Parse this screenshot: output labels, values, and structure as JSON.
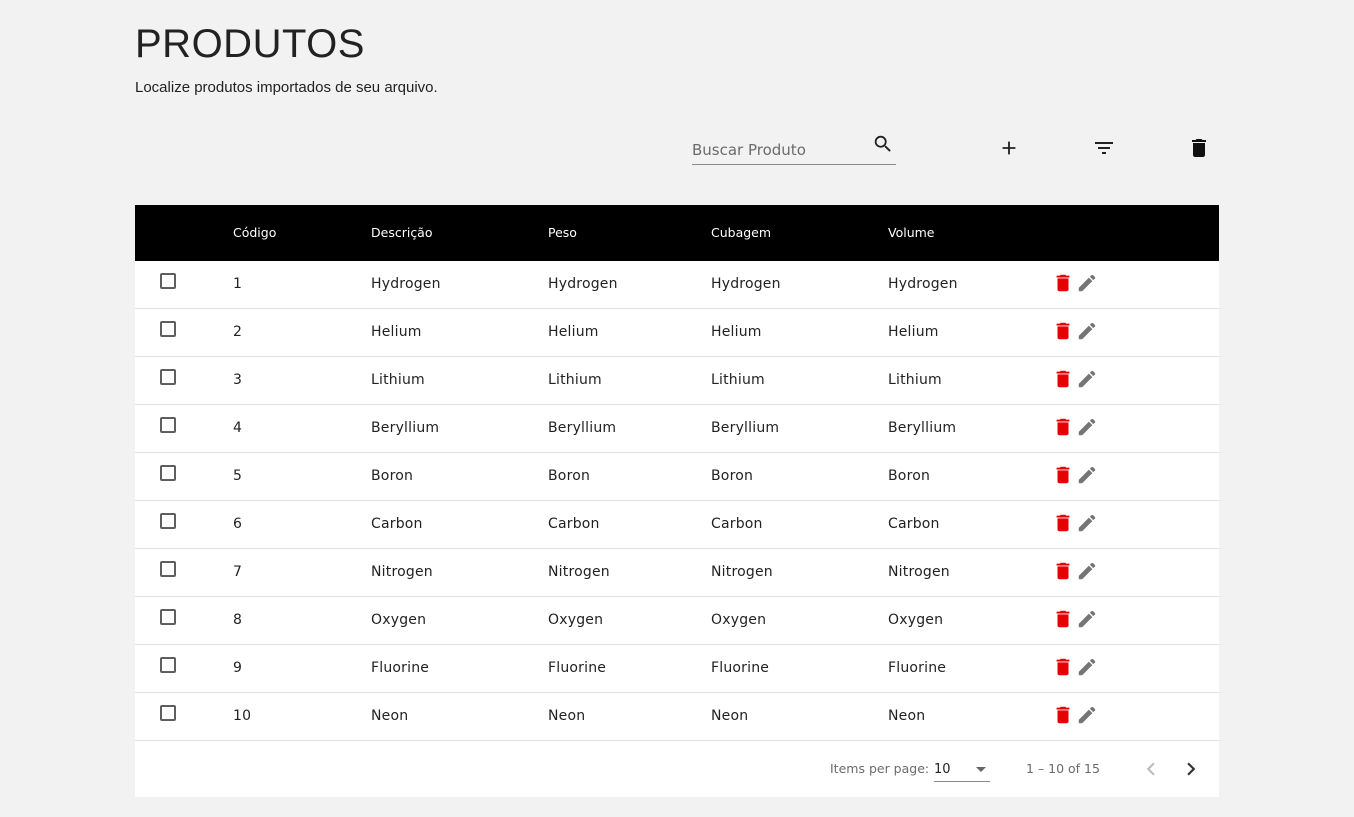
{
  "header": {
    "title": "PRODUTOS",
    "subtitle": "Localize produtos importados de seu arquivo."
  },
  "toolbar": {
    "search_placeholder": "Buscar Produto",
    "search_value": "",
    "icons": [
      "search-icon",
      "add-icon",
      "filter-icon",
      "delete-icon"
    ]
  },
  "table": {
    "columns": [
      "Código",
      "Descrição",
      "Peso",
      "Cubagem",
      "Volume"
    ],
    "rows": [
      {
        "codigo": "1",
        "descricao": "Hydrogen",
        "peso": "Hydrogen",
        "cubagem": "Hydrogen",
        "volume": "Hydrogen",
        "checked": false
      },
      {
        "codigo": "2",
        "descricao": "Helium",
        "peso": "Helium",
        "cubagem": "Helium",
        "volume": "Helium",
        "checked": false
      },
      {
        "codigo": "3",
        "descricao": "Lithium",
        "peso": "Lithium",
        "cubagem": "Lithium",
        "volume": "Lithium",
        "checked": false
      },
      {
        "codigo": "4",
        "descricao": "Beryllium",
        "peso": "Beryllium",
        "cubagem": "Beryllium",
        "volume": "Beryllium",
        "checked": false
      },
      {
        "codigo": "5",
        "descricao": "Boron",
        "peso": "Boron",
        "cubagem": "Boron",
        "volume": "Boron",
        "checked": false
      },
      {
        "codigo": "6",
        "descricao": "Carbon",
        "peso": "Carbon",
        "cubagem": "Carbon",
        "volume": "Carbon",
        "checked": false
      },
      {
        "codigo": "7",
        "descricao": "Nitrogen",
        "peso": "Nitrogen",
        "cubagem": "Nitrogen",
        "volume": "Nitrogen",
        "checked": false
      },
      {
        "codigo": "8",
        "descricao": "Oxygen",
        "peso": "Oxygen",
        "cubagem": "Oxygen",
        "volume": "Oxygen",
        "checked": false
      },
      {
        "codigo": "9",
        "descricao": "Fluorine",
        "peso": "Fluorine",
        "cubagem": "Fluorine",
        "volume": "Fluorine",
        "checked": false
      },
      {
        "codigo": "10",
        "descricao": "Neon",
        "peso": "Neon",
        "cubagem": "Neon",
        "volume": "Neon",
        "checked": false
      }
    ],
    "row_action_icons": [
      "trash-icon",
      "edit-icon"
    ]
  },
  "paginator": {
    "items_per_page_label": "Items per page:",
    "items_per_page_value": "10",
    "range_label": "1 – 10 of 15",
    "icons": [
      "chevron-left-icon",
      "chevron-right-icon"
    ]
  },
  "colors": {
    "background": "#f2f2f2",
    "table_header_bg": "#000000",
    "table_header_text": "#ffffff",
    "delete_action": "#e60000",
    "edit_action": "#757575"
  }
}
